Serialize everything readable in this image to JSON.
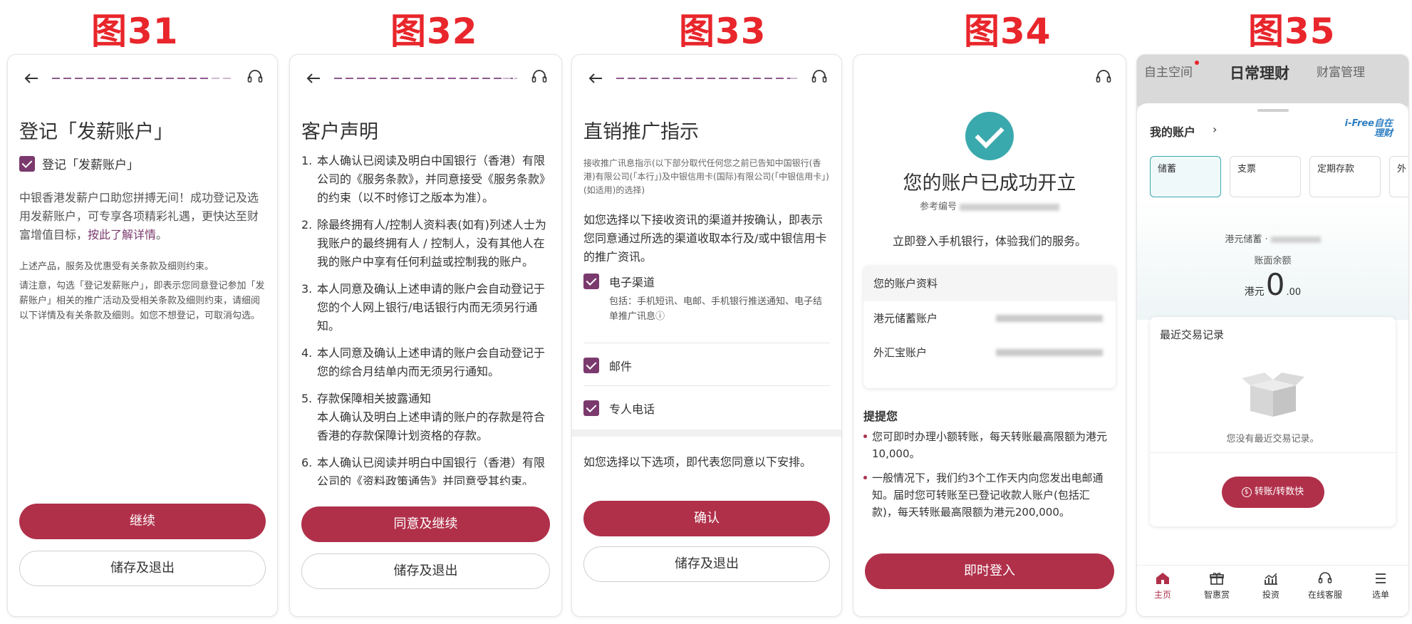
{
  "figure_labels": [
    "图31",
    "图32",
    "图33",
    "图34",
    "图35"
  ],
  "p31": {
    "title": "登记「发薪账户」",
    "checkbox_label": "登记「发薪账户」",
    "intro_text": "中银香港发薪户口助您拼搏无间！成功登记及选用发薪账户，可专享各项精彩礼遇，更快达至财富增值目标，",
    "details_link": "按此了解详情",
    "intro_end": "。",
    "note1": "上述产品，服务及优惠受有关条款及细则约束。",
    "note2": "请注意，勾选「登记发薪账户」，即表示您同意登记参加「发薪账户」相关的推广活动及受相关条款及细则约束，请细阅以下详情及有关条款及细则。如您不想登记，可取消勾选。",
    "continue_btn": "继续",
    "save_exit_btn": "储存及退出"
  },
  "p32": {
    "title": "客户声明",
    "items": [
      {
        "num": "1.",
        "text": "本人确认已阅读及明白中国银行（香港）有限公司的《服务条款》，并同意接受《服务条款》的约束（以不时修订之版本为准）。"
      },
      {
        "num": "2.",
        "text": "除最终拥有人/控制人资料表(如有)列述人士为我账户的最终拥有人 / 控制人，没有其他人在我的账户中享有任何利益或控制我的账户。"
      },
      {
        "num": "3.",
        "text": "本人同意及确认上述申请的账户会自动登记于您的个人网上银行/电话银行内而无须另行通知。"
      },
      {
        "num": "4.",
        "text": "本人同意及确认上述申请的账户会自动登记于您的综合月结单内而无须另行通知。"
      },
      {
        "num": "5.",
        "text": "存款保障相关披露通知\n本人确认及明白上述申请的账户的存款是符合香港的存款保障计划资格的存款。"
      },
      {
        "num": "6.",
        "text": "本人确认已阅读并明白中国银行（香港）有限公司的《资料政策通告》并同意受其约束。"
      }
    ],
    "agree_btn": "同意及继续",
    "save_exit_btn": "储存及退出"
  },
  "p33": {
    "title": "直销推广指示",
    "desc": "接收推广讯息指示(以下部分取代任何您之前已告知中国银行(香港)有限公司(「本行」)及中银信用卡(国际)有限公司(「中银信用卡」)(如适用)的选择)",
    "lead": "如您选择以下接收资讯的渠道并按确认，即表示您同意通过所选的渠道收取本行及/或中银信用卡的推广资讯。",
    "opt_electronic": "电子渠道",
    "opt_electronic_sub": "包括：手机短讯、电邮、手机银行推送通知、电子结单推广讯息",
    "info_glyph": "ⓘ",
    "opt_mail": "邮件",
    "opt_phone": "专人电话",
    "bottom_note": "如您选择以下选项，即代表您同意以下安排。",
    "confirm_btn": "确认",
    "save_exit_btn": "储存及退出"
  },
  "p34": {
    "success_title": "您的账户已成功开立",
    "ref_label": "参考编号",
    "login_hint": "立即登入手机银行，体验我们的服务。",
    "card_header": "您的账户资料",
    "hkd_savings": "港元储蓄账户",
    "fx_account": "外汇宝账户",
    "remind_title": "提提您",
    "remind_1": "您可即时办理小额转账，每天转账最高限额为港元10,000。",
    "remind_2": "一般情况下，我们约3个工作天内向您发出电邮通知。届时您可转账至已登记收款人账户(包括汇款)，每天转账最高限额为港元200,000。",
    "login_btn": "即时登入"
  },
  "p35": {
    "top_tabs": [
      "自主空间",
      "日常理财",
      "财富管理"
    ],
    "my_account": "我的账户",
    "chevron": "›",
    "brand_line1": "i-Free自在",
    "brand_line2": "理财",
    "account_tabs": [
      "储蓄",
      "支票",
      "定期存款",
      "外"
    ],
    "hkd_savings_label": "港元储蓄 ·",
    "balance_label": "账面余额",
    "currency": "港元",
    "balance_int": "0",
    "balance_dec": ".00",
    "recent_tx_title": "最近交易记录",
    "no_tx": "您没有最近交易记录。",
    "transfer_btn": "转账/转数快",
    "transfer_icon_glyph": "$",
    "nav": [
      "主页",
      "智惠赏",
      "投资",
      "在线客服",
      "选单"
    ]
  },
  "colors": {
    "brand": "#b0304a",
    "checkbox": "#7b3a6e",
    "success": "#3aa9ad",
    "figure_label": "#e8262b"
  }
}
